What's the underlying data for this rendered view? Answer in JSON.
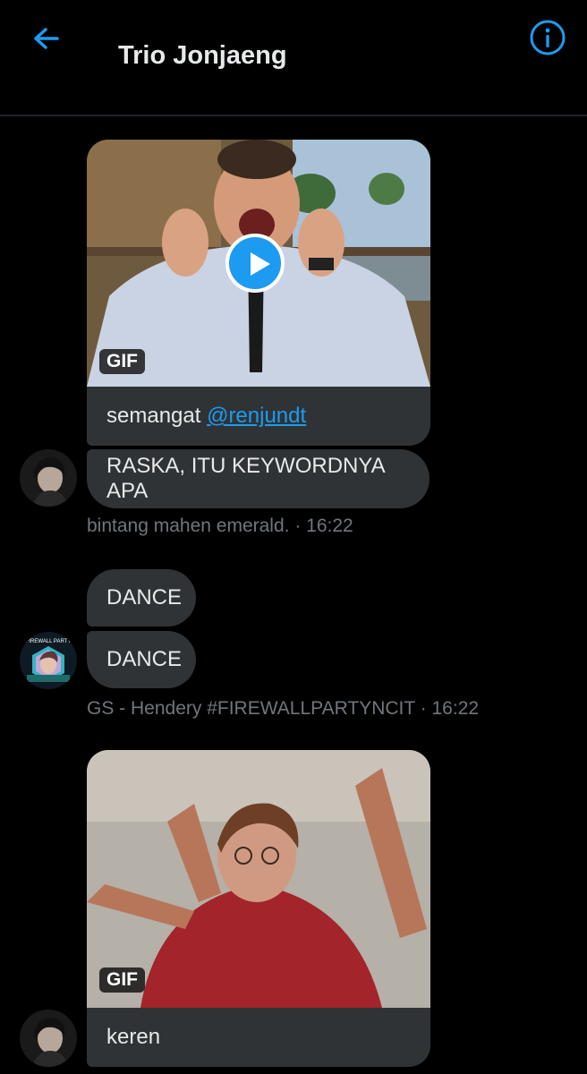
{
  "header": {
    "title": "Trio Jonjaeng"
  },
  "messages": {
    "m1": {
      "gif_label": "GIF",
      "caption": "semangat ",
      "mention": "@renjundt"
    },
    "m2": {
      "text": "RASKA, ITU KEYWORDNYA APA"
    },
    "meta1": {
      "sender": "bintang mahen emerald.",
      "time": "16:22",
      "separator": " · "
    },
    "m3": {
      "text": "DANCE"
    },
    "m4": {
      "text": "DANCE"
    },
    "meta2": {
      "sender": "GS - Hendery #FIREWALLPARTYNCIT",
      "time": "16:22",
      "separator": " · "
    },
    "m5": {
      "gif_label": "GIF",
      "caption": "keren"
    },
    "avatar2_text": "FIREWALL PARTY"
  },
  "colors": {
    "accent": "#1d9bf0",
    "bubble": "#2f3336",
    "background": "#000000",
    "meta": "#71767b"
  }
}
